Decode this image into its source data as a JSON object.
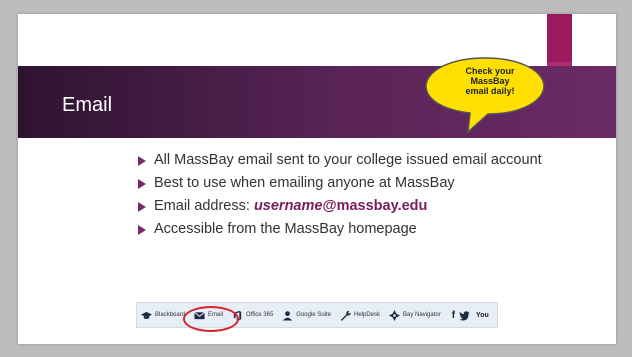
{
  "slide": {
    "title": "Email",
    "callout": "Check your\nMassBay\nemail daily!",
    "bullets": [
      "All MassBay email sent to your college issued email account",
      "Best to use when emailing anyone at MassBay",
      "Accessible from the MassBay homepage"
    ],
    "email_prefix": "Email address: ",
    "email_user": "username",
    "email_domain": "@massbay.edu"
  },
  "toolbar": {
    "items": [
      {
        "label": "Blackboard",
        "icon": "graduation-cap-icon"
      },
      {
        "label": "Email",
        "icon": "envelope-icon"
      },
      {
        "label": "Office 365",
        "icon": "office-icon"
      },
      {
        "label": "Google Suite",
        "icon": "user-icon"
      },
      {
        "label": "HelpDesk",
        "icon": "wrench-icon"
      },
      {
        "label": "Bay Navigator",
        "icon": "compass-icon"
      }
    ],
    "social": [
      "f",
      "t",
      "You"
    ]
  },
  "colors": {
    "title_bar": "#5a2457",
    "accent": "#9c1b5f",
    "email_highlight": "#7a1f5c",
    "circle": "#d9222a"
  }
}
